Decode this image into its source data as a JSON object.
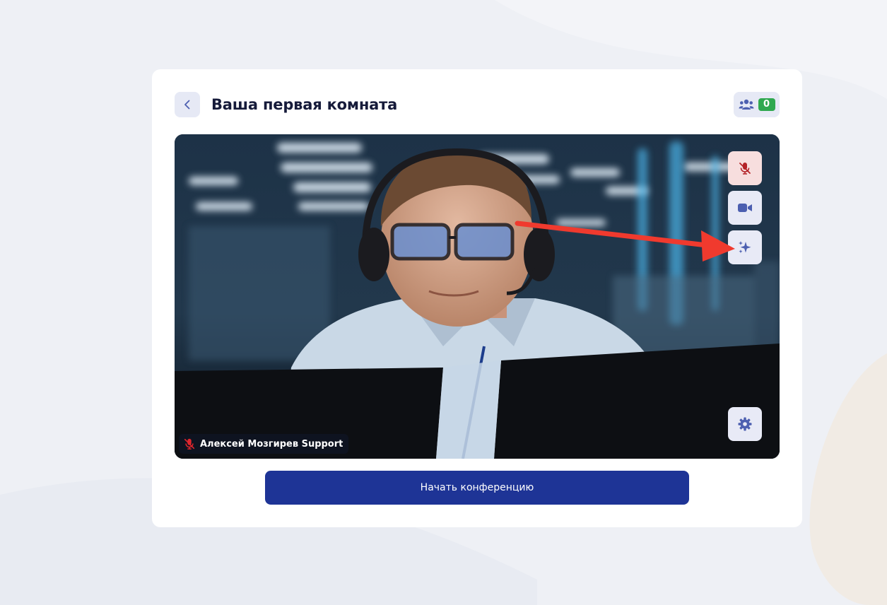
{
  "room": {
    "title": "Ваша первая комната",
    "participants_count": "0"
  },
  "video": {
    "user_name": "Алексей Мозгирев Support",
    "mic_state": "muted"
  },
  "controls": {
    "mic_icon": "mic-off-icon",
    "camera_icon": "video-camera-icon",
    "effects_icon": "sparkles-icon",
    "settings_icon": "gear-icon"
  },
  "actions": {
    "start_label": "Начать конференцию"
  },
  "colors": {
    "primary": "#1e3496",
    "muted_red": "#d9282f",
    "badge_green": "#2fa84f",
    "annotation_arrow": "#f03a2e"
  }
}
